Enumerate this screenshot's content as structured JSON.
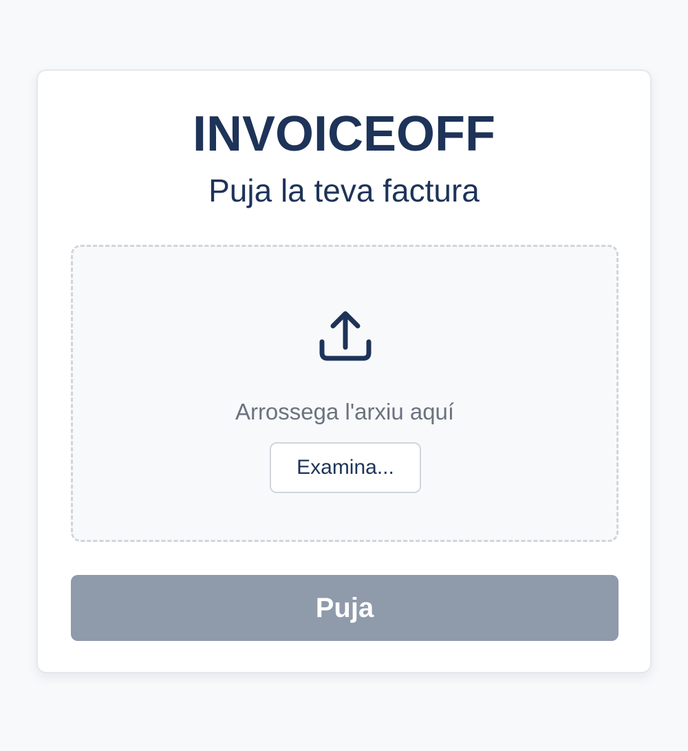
{
  "app": {
    "brand": "INVOICEOFF",
    "subtitle": "Puja la teva factura"
  },
  "dropzone": {
    "icon": "upload-icon",
    "prompt": "Arrossega l'arxiu aquí",
    "browse_label": "Examina..."
  },
  "actions": {
    "submit_label": "Puja",
    "submit_state": "disabled"
  },
  "colors": {
    "brand": "#1e3358",
    "muted_text": "#6b7280",
    "disabled_button": "#8f9aab",
    "background": "#f8f9fb",
    "dashed_border": "#d1d5db"
  }
}
